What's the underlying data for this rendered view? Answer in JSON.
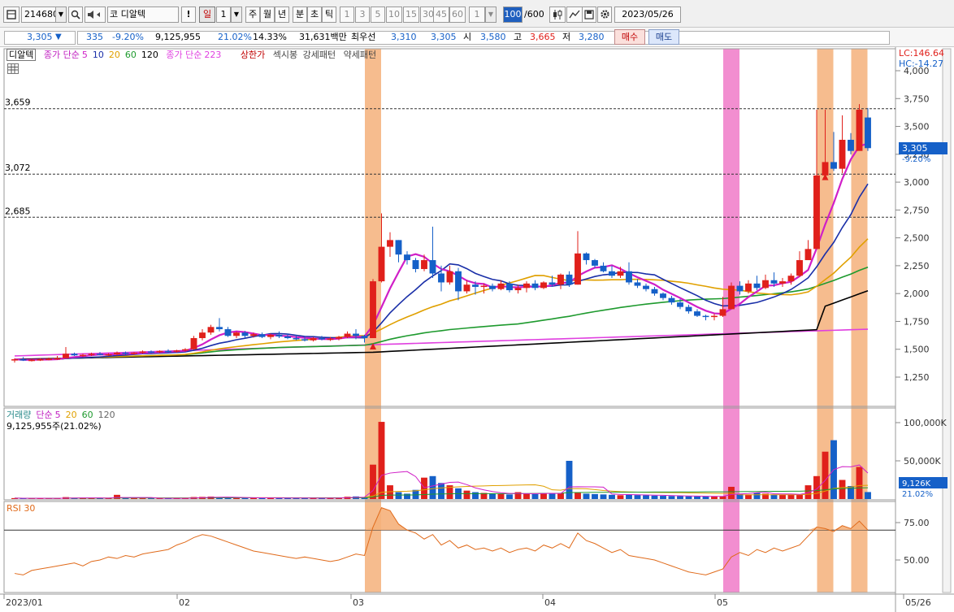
{
  "toolbar": {
    "code": "214680",
    "code_prefix": "코",
    "stock_name": "디알텍",
    "alert_label": "!",
    "period_day": "일",
    "period_value": "1",
    "periods": [
      "주",
      "월",
      "년",
      "분",
      "초",
      "틱"
    ],
    "intervals": [
      "1",
      "3",
      "5",
      "10",
      "15",
      "30",
      "45",
      "60"
    ],
    "interval_select": "1",
    "count_current": "100",
    "count_total": "/600",
    "date": "2023/05/26"
  },
  "info": {
    "price": "3,305",
    "change_arrow": "▼",
    "change": "335",
    "change_pct": "-9.20%",
    "volume": "9,125,955",
    "volume_pct": "21.02%",
    "turnover_pct": "14.33%",
    "amount": "31,631백만",
    "best_label": "최우선",
    "best_ask": "3,310",
    "best_bid": "3,305",
    "open_label": "시",
    "open": "3,580",
    "high_label": "고",
    "high": "3,665",
    "low_label": "저",
    "low": "3,280",
    "buy_label": "매수",
    "sell_label": "매도"
  },
  "legend": {
    "name": "디알텍",
    "ma_label": "종가 단순",
    "ma_periods": [
      "5",
      "10",
      "20",
      "60",
      "120"
    ],
    "ma2_label": "종가 단순",
    "ma2_period": "223",
    "upper_limit": "상한가",
    "patterns": [
      "섹시봉",
      "강세패턴",
      "약세패턴"
    ],
    "lc": "LC:146.64",
    "hc": "HC:-14.27"
  },
  "volume_legend": {
    "title": "거래량",
    "ma_label": "단순",
    "periods": [
      "5",
      "20",
      "60",
      "120"
    ],
    "value": "9,125,955주(21.02%)",
    "axis_labels": [
      "100,000K",
      "50,000K"
    ],
    "current": "9,126K",
    "current_pct": "21.02%"
  },
  "rsi_legend": {
    "title": "RSI 30",
    "axis_labels": [
      "75.00",
      "50.00"
    ]
  },
  "price_axis": {
    "labels": [
      "4,000",
      "3,750",
      "3,500",
      "3,250",
      "3,000",
      "2,750",
      "2,500",
      "2,250",
      "2,000",
      "1,750",
      "1,500",
      "1,250"
    ],
    "current": "3,305",
    "current_pct": "-9.20%"
  },
  "level_lines": [
    "3,659",
    "3,072",
    "2,685"
  ],
  "date_axis": [
    "2023/01",
    "02",
    "03",
    "04",
    "05",
    "05/26"
  ],
  "colors": {
    "up": "#e0201b",
    "down": "#1560c8",
    "ma5": "#d01fc7",
    "ma10": "#1a2fa8",
    "ma20": "#e0a000",
    "ma60": "#1e9a2e",
    "ma120": "#000000",
    "ma223": "#e040e0",
    "highlight_orange": "#f5b07a",
    "highlight_pink": "#f07ac8",
    "rsi": "#e06a1a"
  },
  "chart_data": {
    "type": "candlestick",
    "ylim": [
      1100,
      4100
    ],
    "volume_ylim": [
      0,
      110000
    ],
    "rsi_ylim": [
      30,
      90
    ],
    "candles": [
      [
        1400,
        1420,
        1380,
        1410
      ],
      [
        1410,
        1430,
        1395,
        1400
      ],
      [
        1400,
        1415,
        1390,
        1405
      ],
      [
        1405,
        1420,
        1395,
        1410
      ],
      [
        1410,
        1425,
        1400,
        1415
      ],
      [
        1415,
        1440,
        1405,
        1420
      ],
      [
        1420,
        1520,
        1430,
        1460
      ],
      [
        1460,
        1470,
        1440,
        1445
      ],
      [
        1445,
        1460,
        1430,
        1450
      ],
      [
        1450,
        1470,
        1440,
        1460
      ],
      [
        1460,
        1475,
        1445,
        1450
      ],
      [
        1450,
        1465,
        1440,
        1455
      ],
      [
        1455,
        1480,
        1445,
        1470
      ],
      [
        1470,
        1480,
        1450,
        1460
      ],
      [
        1460,
        1475,
        1450,
        1470
      ],
      [
        1470,
        1490,
        1460,
        1480
      ],
      [
        1480,
        1490,
        1465,
        1475
      ],
      [
        1475,
        1490,
        1465,
        1485
      ],
      [
        1485,
        1500,
        1470,
        1480
      ],
      [
        1480,
        1495,
        1470,
        1490
      ],
      [
        1490,
        1510,
        1480,
        1500
      ],
      [
        1500,
        1620,
        1495,
        1600
      ],
      [
        1600,
        1680,
        1580,
        1650
      ],
      [
        1650,
        1720,
        1630,
        1700
      ],
      [
        1700,
        1780,
        1660,
        1680
      ],
      [
        1680,
        1700,
        1610,
        1620
      ],
      [
        1620,
        1660,
        1600,
        1650
      ],
      [
        1650,
        1665,
        1600,
        1620
      ],
      [
        1620,
        1650,
        1605,
        1635
      ],
      [
        1635,
        1650,
        1600,
        1610
      ],
      [
        1610,
        1640,
        1590,
        1630
      ],
      [
        1630,
        1660,
        1600,
        1615
      ],
      [
        1615,
        1640,
        1590,
        1600
      ],
      [
        1600,
        1625,
        1580,
        1590
      ],
      [
        1590,
        1620,
        1570,
        1580
      ],
      [
        1580,
        1610,
        1570,
        1600
      ],
      [
        1600,
        1620,
        1580,
        1590
      ],
      [
        1590,
        1610,
        1575,
        1595
      ],
      [
        1595,
        1620,
        1580,
        1610
      ],
      [
        1610,
        1660,
        1600,
        1640
      ],
      [
        1640,
        1680,
        1590,
        1620
      ],
      [
        1620,
        1630,
        1560,
        1600
      ],
      [
        1600,
        2130,
        1600,
        2110
      ],
      [
        2110,
        2720,
        2100,
        2420
      ],
      [
        2420,
        2550,
        2330,
        2480
      ],
      [
        2480,
        2480,
        2280,
        2350
      ],
      [
        2350,
        2380,
        2260,
        2300
      ],
      [
        2300,
        2320,
        2190,
        2220
      ],
      [
        2220,
        2350,
        2200,
        2300
      ],
      [
        2300,
        2600,
        2140,
        2180
      ],
      [
        2180,
        2250,
        2020,
        2100
      ],
      [
        2100,
        2250,
        2080,
        2200
      ],
      [
        2200,
        2230,
        1940,
        2020
      ],
      [
        2020,
        2120,
        2000,
        2080
      ],
      [
        2080,
        2110,
        1990,
        2060
      ],
      [
        2060,
        2090,
        2000,
        2070
      ],
      [
        2070,
        2090,
        2020,
        2040
      ],
      [
        2040,
        2120,
        2030,
        2090
      ],
      [
        2090,
        2110,
        2010,
        2030
      ],
      [
        2030,
        2080,
        2000,
        2050
      ],
      [
        2050,
        2110,
        2010,
        2090
      ],
      [
        2090,
        2120,
        2030,
        2050
      ],
      [
        2050,
        2110,
        2040,
        2100
      ],
      [
        2100,
        2160,
        2060,
        2080
      ],
      [
        2080,
        2180,
        2040,
        2170
      ],
      [
        2170,
        2200,
        2060,
        2080
      ],
      [
        2080,
        2560,
        2080,
        2360
      ],
      [
        2360,
        2370,
        2260,
        2300
      ],
      [
        2300,
        2310,
        2230,
        2250
      ],
      [
        2250,
        2280,
        2190,
        2200
      ],
      [
        2200,
        2250,
        2140,
        2160
      ],
      [
        2160,
        2240,
        2140,
        2200
      ],
      [
        2200,
        2280,
        2080,
        2100
      ],
      [
        2100,
        2130,
        2050,
        2070
      ],
      [
        2070,
        2090,
        2020,
        2040
      ],
      [
        2040,
        2060,
        1980,
        2000
      ],
      [
        2000,
        2010,
        1940,
        1960
      ],
      [
        1960,
        1980,
        1900,
        1920
      ],
      [
        1920,
        1950,
        1860,
        1880
      ],
      [
        1880,
        1900,
        1820,
        1840
      ],
      [
        1840,
        1860,
        1790,
        1800
      ],
      [
        1800,
        1810,
        1760,
        1790
      ],
      [
        1790,
        1820,
        1760,
        1800
      ],
      [
        1800,
        1970,
        1790,
        1860
      ],
      [
        1860,
        2100,
        1860,
        2070
      ],
      [
        2070,
        2110,
        1990,
        2020
      ],
      [
        2020,
        2120,
        2000,
        2090
      ],
      [
        2090,
        2160,
        2030,
        2050
      ],
      [
        2050,
        2170,
        2040,
        2120
      ],
      [
        2120,
        2190,
        2060,
        2090
      ],
      [
        2090,
        2140,
        2060,
        2110
      ],
      [
        2110,
        2180,
        2080,
        2160
      ],
      [
        2160,
        2380,
        2150,
        2300
      ],
      [
        2300,
        2480,
        2320,
        2400
      ],
      [
        2400,
        3650,
        2500,
        3060
      ],
      [
        3060,
        3650,
        3120,
        3180
      ],
      [
        3180,
        3450,
        3100,
        3120
      ],
      [
        3120,
        3600,
        3080,
        3380
      ],
      [
        3380,
        3440,
        3250,
        3280
      ],
      [
        3280,
        3700,
        3300,
        3650
      ],
      [
        3580,
        3665,
        3280,
        3305
      ]
    ],
    "volumes": [
      1200,
      900,
      800,
      1100,
      900,
      1000,
      2500,
      1400,
      1200,
      1100,
      1000,
      1000,
      5500,
      1300,
      1100,
      1000,
      1000,
      900,
      800,
      1000,
      1200,
      2600,
      2800,
      3200,
      2100,
      1800,
      1700,
      1500,
      1400,
      1300,
      1400,
      1500,
      1300,
      1200,
      1100,
      1200,
      1300,
      1400,
      1500,
      3000,
      3400,
      2500,
      45000,
      101000,
      18000,
      9000,
      7000,
      12000,
      28000,
      30000,
      21000,
      18000,
      14000,
      11000,
      9000,
      8000,
      7000,
      6500,
      6000,
      9000,
      7000,
      6500,
      7500,
      7000,
      8000,
      50000,
      8000,
      7000,
      6500,
      6000,
      5500,
      5000,
      6000,
      5200,
      4800,
      4500,
      4200,
      4000,
      3800,
      3600,
      3500,
      3300,
      3400,
      3600,
      16000,
      7000,
      6000,
      8500,
      7000,
      6000,
      5500,
      6000,
      5800,
      18000,
      30000,
      62000,
      77000,
      25000,
      17000,
      42000,
      9126
    ],
    "rsi": [
      41,
      40,
      43,
      44,
      45,
      46,
      47,
      48,
      46,
      49,
      50,
      52,
      51,
      53,
      52,
      54,
      55,
      56,
      57,
      60,
      62,
      65,
      67,
      66,
      64,
      62,
      60,
      58,
      56,
      55,
      54,
      53,
      52,
      51,
      52,
      51,
      50,
      49,
      50,
      52,
      54,
      53,
      72,
      85,
      83,
      74,
      70,
      68,
      64,
      67,
      60,
      63,
      58,
      60,
      57,
      58,
      56,
      58,
      55,
      57,
      58,
      56,
      60,
      58,
      61,
      58,
      68,
      63,
      61,
      58,
      55,
      57,
      53,
      52,
      51,
      50,
      48,
      46,
      44,
      42,
      41,
      40,
      42,
      44,
      52,
      55,
      53,
      57,
      55,
      58,
      56,
      58,
      60,
      66,
      72,
      71,
      69,
      73,
      71,
      76,
      70
    ]
  }
}
